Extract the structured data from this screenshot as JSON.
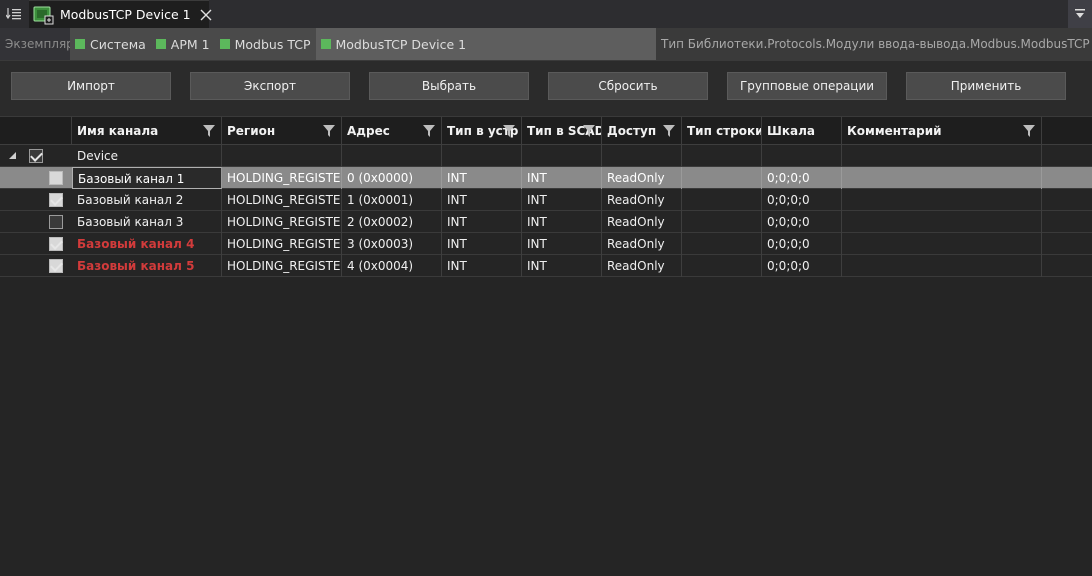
{
  "tabstrip": {
    "menu_icon": "panel-list-icon",
    "tab": {
      "title": "ModbusTCP Device 1",
      "icon": "device-board-icon",
      "close_icon": "close-icon"
    },
    "overflow_icon": "dropdown-overflow-icon"
  },
  "breadcrumb": {
    "label": "Экземпляр",
    "items": [
      "Система",
      "АРМ 1",
      "Modbus TCP",
      "ModbusTCP Device 1"
    ],
    "type_path": "Тип Библиотеки.Protocols.Модули ввода-вывода.Modbus.ModbusTCP Device"
  },
  "toolbar": {
    "import": "Импорт",
    "export": "Экспорт",
    "select": "Выбрать",
    "reset": "Сбросить",
    "group_ops": "Групповые операции",
    "apply": "Применить"
  },
  "grid": {
    "columns": [
      "Имя канала",
      "Регион",
      "Адрес",
      "Тип в устр",
      "Тип в SCAD",
      "Доступ",
      "Тип строки",
      "Шкала",
      "Комментарий"
    ],
    "group": {
      "name": "Device",
      "checked": true
    },
    "rows": [
      {
        "checked": false,
        "name": "Базовый канал 1",
        "region": "HOLDING_REGISTERS",
        "address": "0 (0x0000)",
        "dev_type": "INT",
        "scada_type": "INT",
        "access": "ReadOnly",
        "str_type": "",
        "scale": "0;0;0;0",
        "comment": ""
      },
      {
        "checked": true,
        "name": "Базовый канал 2",
        "region": "HOLDING_REGISTERS",
        "address": "1 (0x0001)",
        "dev_type": "INT",
        "scada_type": "INT",
        "access": "ReadOnly",
        "str_type": "",
        "scale": "0;0;0;0",
        "comment": ""
      },
      {
        "checked": false,
        "name": "Базовый канал 3",
        "region": "HOLDING_REGISTERS",
        "address": "2 (0x0002)",
        "dev_type": "INT",
        "scada_type": "INT",
        "access": "ReadOnly",
        "str_type": "",
        "scale": "0;0;0;0",
        "comment": ""
      },
      {
        "checked": true,
        "name": "Базовый канал 4",
        "region": "HOLDING_REGISTERS",
        "address": "3 (0x0003)",
        "dev_type": "INT",
        "scada_type": "INT",
        "access": "ReadOnly",
        "str_type": "",
        "scale": "0;0;0;0",
        "comment": ""
      },
      {
        "checked": true,
        "name": "Базовый канал 5",
        "region": "HOLDING_REGISTERS",
        "address": "4 (0x0004)",
        "dev_type": "INT",
        "scada_type": "INT",
        "access": "ReadOnly",
        "str_type": "",
        "scale": "0;0;0;0",
        "comment": ""
      }
    ]
  },
  "colors": {
    "accent_green": "#5cb85c",
    "error_red": "#d23b3b",
    "selected_row": "#8a8a8a"
  }
}
